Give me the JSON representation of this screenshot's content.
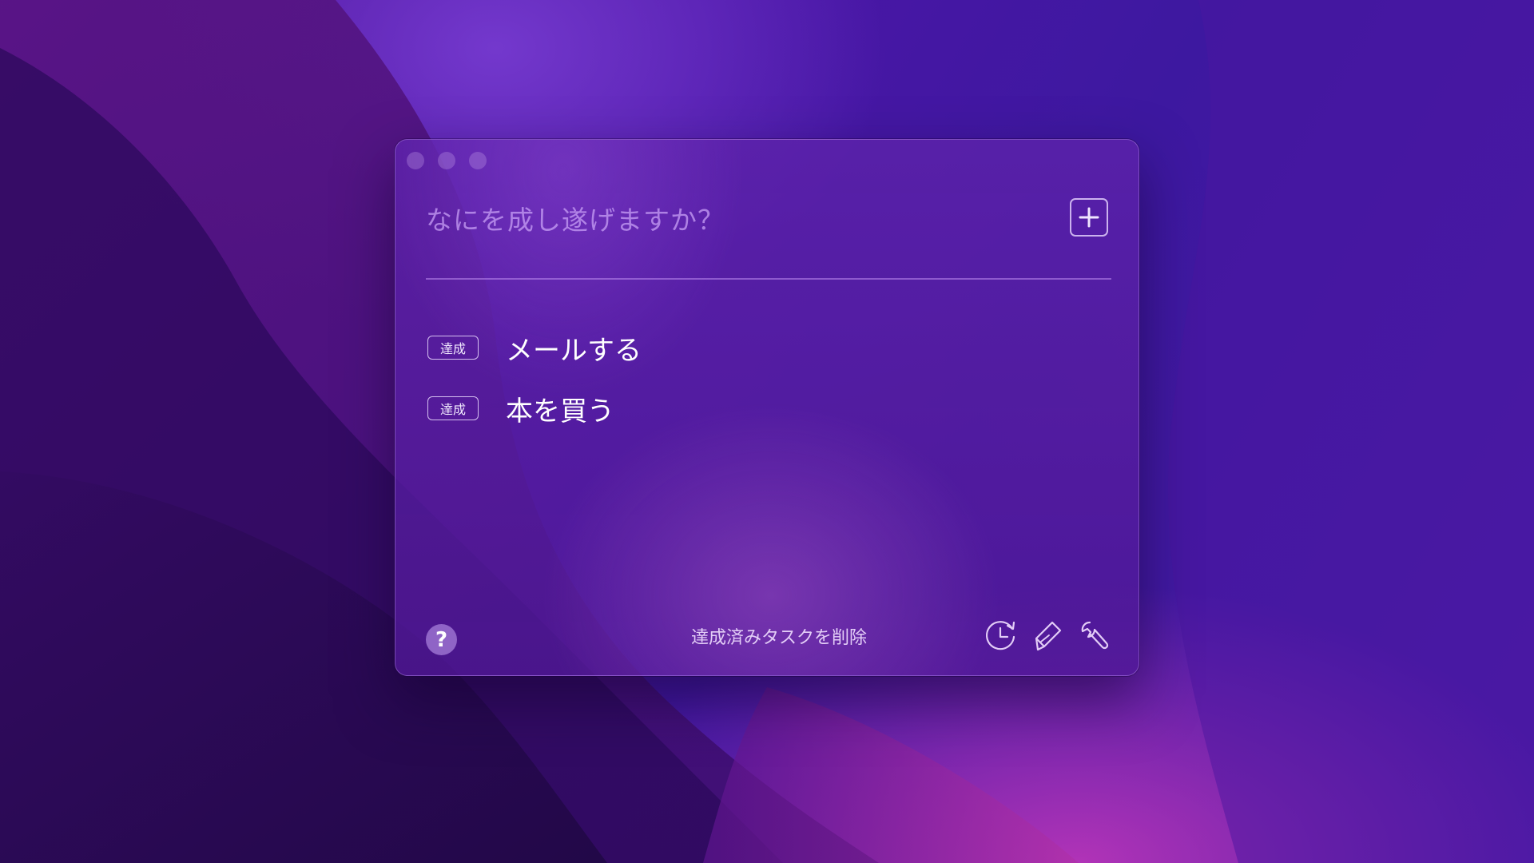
{
  "colors": {
    "accent": "#9b4fd6",
    "window_bg": "#5a2294",
    "placeholder": "#c8a0f5",
    "text": "#ffffff"
  },
  "window": {
    "traffic_lights": [
      "close",
      "minimize",
      "zoom"
    ]
  },
  "input": {
    "placeholder": "なにを成し遂げますか？",
    "value": ""
  },
  "add_button": {
    "icon": "plus-icon"
  },
  "tasks": [
    {
      "action_label": "達成",
      "text": "メールする"
    },
    {
      "action_label": "達成",
      "text": "本を買う"
    }
  ],
  "footer": {
    "help_label": "?",
    "clear_label": "達成済みタスクを削除",
    "icons": [
      "history-icon",
      "pen-icon",
      "wrench-icon"
    ]
  }
}
